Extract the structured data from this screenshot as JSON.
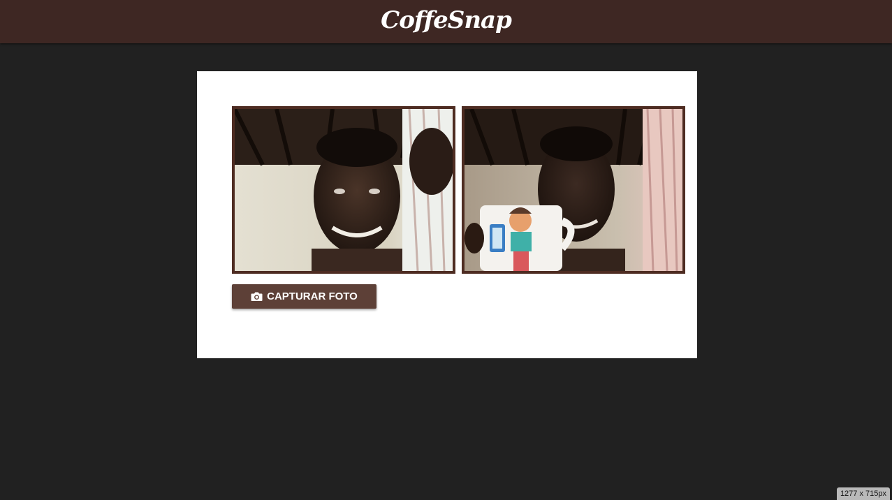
{
  "header": {
    "title": "CoffeSnap"
  },
  "photos": [
    {
      "name": "webcam-live-view"
    },
    {
      "name": "captured-photo"
    }
  ],
  "capture_button": {
    "label": "CAPTURAR FOTO",
    "icon": "camera-icon"
  },
  "viewport_badge": "1277 x 715px",
  "colors": {
    "header": "#3e2723",
    "background": "#212121",
    "card": "#ffffff",
    "frame_border": "#4e2c22",
    "button": "#5d4037"
  }
}
